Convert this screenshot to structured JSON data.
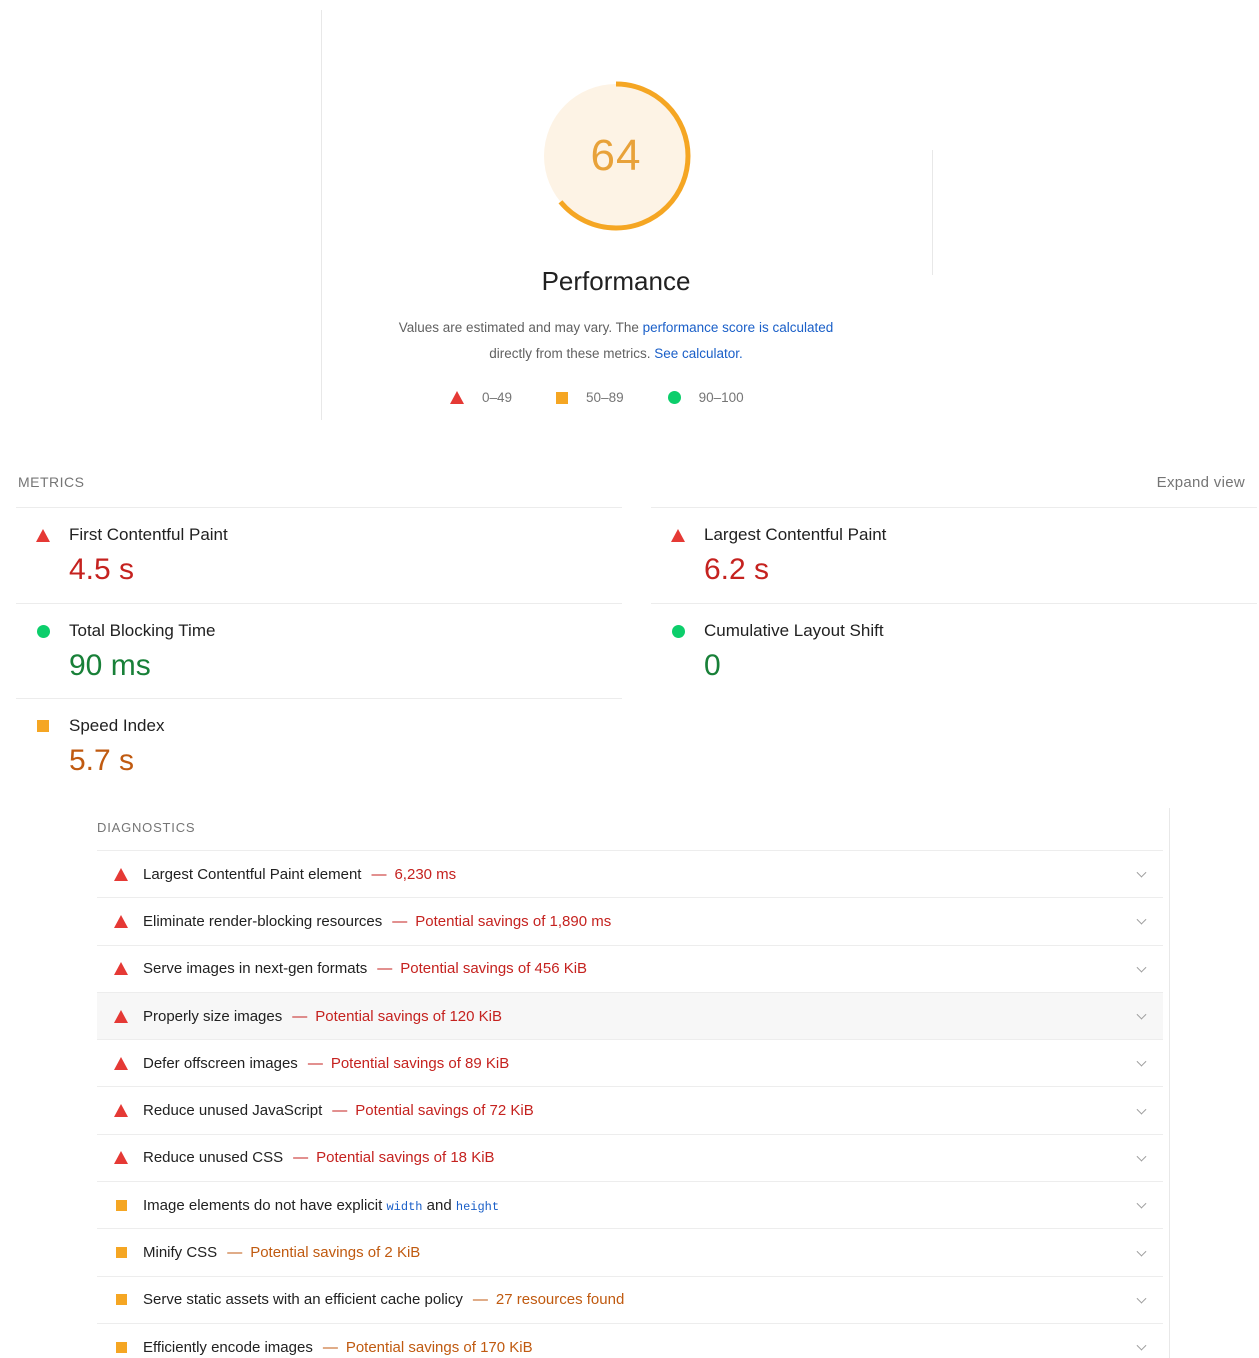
{
  "score": {
    "value": "64",
    "fraction": 0.64,
    "color": "#f5a623",
    "bg": "#fdf3e5"
  },
  "category": {
    "title": "Performance",
    "note_text": "Values are estimated and may vary. The ",
    "note_link": "performance score is calculated",
    "note_text2": "directly from these metrics. ",
    "note_link2": "See calculator."
  },
  "legend": [
    {
      "icon": "fail-triangle-icon",
      "label": "0–49"
    },
    {
      "icon": "average-square-icon",
      "label": "50–89"
    },
    {
      "icon": "pass-circle-icon",
      "label": "90–100"
    }
  ],
  "metrics": {
    "header": "METRICS",
    "expand": "Expand view",
    "items": [
      {
        "name": "First Contentful Paint",
        "value": "4.5 s",
        "rating": "fail"
      },
      {
        "name": "Largest Contentful Paint",
        "value": "6.2 s",
        "rating": "fail"
      },
      {
        "name": "Total Blocking Time",
        "value": "90 ms",
        "rating": "pass"
      },
      {
        "name": "Cumulative Layout Shift",
        "value": "0",
        "rating": "pass"
      },
      {
        "name": "Speed Index",
        "value": "5.7 s",
        "rating": "average"
      }
    ]
  },
  "diagnostics": {
    "header": "DIAGNOSTICS",
    "items": [
      {
        "title": "Largest Contentful Paint element",
        "detail": "6,230 ms",
        "rating": "fail"
      },
      {
        "title": "Eliminate render-blocking resources",
        "detail": "Potential savings of 1,890 ms",
        "rating": "fail"
      },
      {
        "title": "Serve images in next-gen formats",
        "detail": "Potential savings of 456 KiB",
        "rating": "fail"
      },
      {
        "title": "Properly size images",
        "detail": "Potential savings of 120 KiB",
        "rating": "fail"
      },
      {
        "title": "Defer offscreen images",
        "detail": "Potential savings of 89 KiB",
        "rating": "fail"
      },
      {
        "title": "Reduce unused JavaScript",
        "detail": "Potential savings of 72 KiB",
        "rating": "fail"
      },
      {
        "title": "Reduce unused CSS",
        "detail": "Potential savings of 18 KiB",
        "rating": "fail"
      },
      {
        "title": "Image elements do not have explicit",
        "code1": "width",
        "and": "and",
        "code2": "height",
        "detail": "",
        "rating": "average"
      },
      {
        "title": "Minify CSS",
        "detail": "Potential savings of 2 KiB",
        "rating": "average"
      },
      {
        "title": "Serve static assets with an efficient cache policy",
        "detail": "27 resources found",
        "rating": "average"
      },
      {
        "title": "Efficiently encode images",
        "detail": "Potential savings of 170 KiB",
        "rating": "average"
      }
    ]
  }
}
